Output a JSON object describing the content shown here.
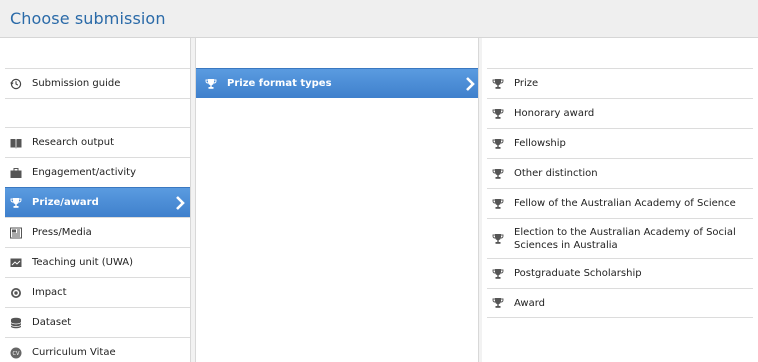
{
  "header": {
    "title": "Choose submission"
  },
  "column1": {
    "items": [
      {
        "label": "Submission guide",
        "icon": "history-icon"
      },
      {
        "label": "Research output",
        "icon": "book-icon"
      },
      {
        "label": "Engagement/activity",
        "icon": "briefcase-icon"
      },
      {
        "label": "Prize/award",
        "icon": "trophy-icon",
        "active": true
      },
      {
        "label": "Press/Media",
        "icon": "newspaper-icon"
      },
      {
        "label": "Teaching unit (UWA)",
        "icon": "presentation-icon"
      },
      {
        "label": "Impact",
        "icon": "target-icon"
      },
      {
        "label": "Dataset",
        "icon": "database-icon"
      },
      {
        "label": "Curriculum Vitae",
        "icon": "cv-icon"
      }
    ]
  },
  "column2": {
    "items": [
      {
        "label": "Prize format types",
        "icon": "trophy-icon",
        "active": true
      }
    ]
  },
  "column3": {
    "items": [
      {
        "label": "Prize",
        "icon": "trophy-icon"
      },
      {
        "label": "Honorary award",
        "icon": "trophy-icon"
      },
      {
        "label": "Fellowship",
        "icon": "trophy-icon"
      },
      {
        "label": "Other distinction",
        "icon": "trophy-icon"
      },
      {
        "label": "Fellow of the Australian Academy of Science",
        "icon": "trophy-icon"
      },
      {
        "label": "Election to the Australian Academy of Social Sciences in Australia",
        "icon": "trophy-icon"
      },
      {
        "label": "Postgraduate Scholarship",
        "icon": "trophy-icon"
      },
      {
        "label": "Award",
        "icon": "trophy-icon"
      }
    ]
  },
  "colors": {
    "accent": "#4a8bd6",
    "title": "#2a6aa8",
    "icon": "#555555"
  }
}
